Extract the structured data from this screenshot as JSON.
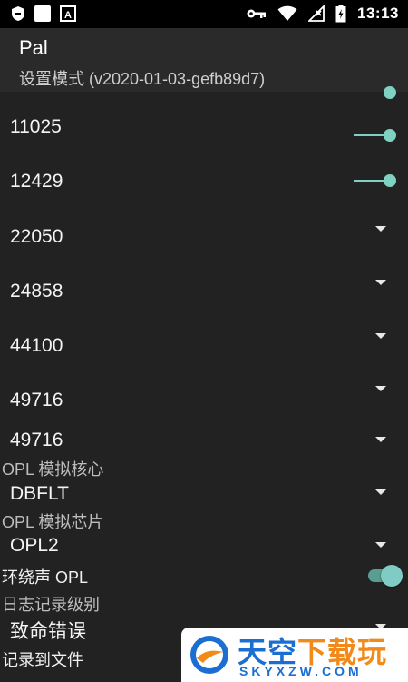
{
  "status_bar": {
    "time": "13:13"
  },
  "header": {
    "title": "Pal",
    "subtitle": "设置模式 (v2020-01-03-gefb89d7)"
  },
  "settings": {
    "row1_value": "11025",
    "row2_value": "12429",
    "row3_value": "22050",
    "row4_value": "24858",
    "row5_value": "44100",
    "row6_value": "49716",
    "row7_value": "49716",
    "opl_core_label": "OPL 模拟核心",
    "opl_core_value": "DBFLT",
    "opl_chip_label": "OPL 模拟芯片",
    "opl_chip_value": "OPL2",
    "surround_label": "环绕声 OPL",
    "surround_enabled": true,
    "log_level_label": "日志记录级别",
    "log_level_value": "致命错误",
    "log_file_label": "记录到文件"
  },
  "watermark": {
    "title_part1": "天空",
    "title_part2": "下载玩",
    "subtitle": "SKYXZW.COM"
  },
  "colors": {
    "accent": "#80cbc4",
    "header_bg": "#2a2a2a",
    "content_bg": "#222222"
  }
}
